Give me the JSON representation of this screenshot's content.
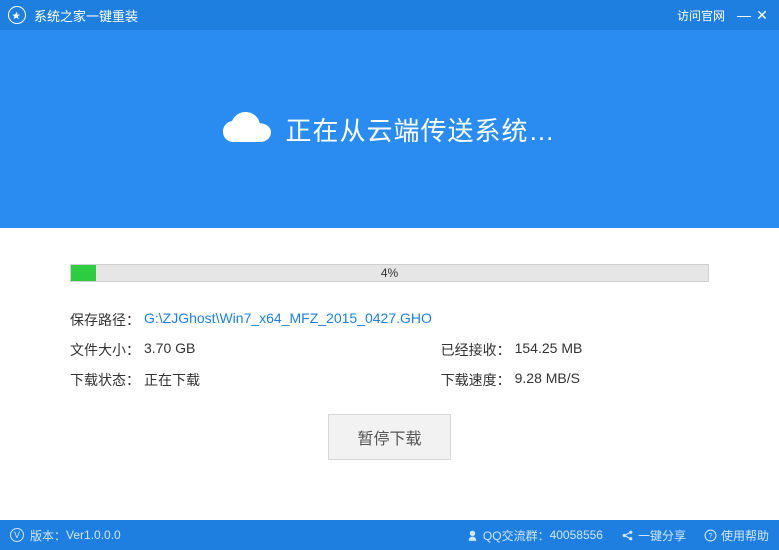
{
  "titlebar": {
    "app_name": "系统之家一键重装",
    "visit_link": "访问官网"
  },
  "hero": {
    "heading": "正在从云端传送系统…"
  },
  "progress": {
    "percent": 4,
    "percent_text": "4%"
  },
  "info": {
    "save_path_label": "保存路径：",
    "save_path_value": "G:\\ZJGhost\\Win7_x64_MFZ_2015_0427.GHO",
    "file_size_label": "文件大小：",
    "file_size_value": "3.70 GB",
    "received_label": "已经接收：",
    "received_value": "154.25 MB",
    "status_label": "下载状态：",
    "status_value": "正在下载",
    "speed_label": "下载速度：",
    "speed_value": "9.28 MB/S"
  },
  "actions": {
    "pause_label": "暂停下载"
  },
  "footer": {
    "version_label": "版本：",
    "version_value": "Ver1.0.0.0",
    "qq_label": "QQ交流群：",
    "qq_value": "40058556",
    "share_label": "一键分享",
    "help_label": "使用帮助"
  },
  "colors": {
    "primary": "#1e7fe0",
    "hero": "#2a8cf0",
    "progress_fill": "#2ecc40"
  }
}
